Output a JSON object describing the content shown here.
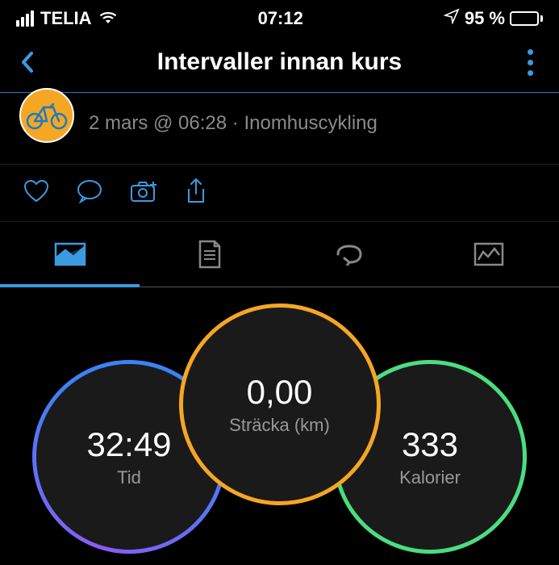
{
  "status": {
    "carrier": "TELIA",
    "time": "07:12",
    "battery_pct": "95 %"
  },
  "nav": {
    "title": "Intervaller innan kurs"
  },
  "activity": {
    "timestamp": "2 mars @ 06:28",
    "type": "Inomhuscykling"
  },
  "metrics": {
    "distance": {
      "value": "0,00",
      "label": "Sträcka (km)"
    },
    "time": {
      "value": "32:49",
      "label": "Tid"
    },
    "calories": {
      "value": "333",
      "label": "Kalorier"
    }
  },
  "colors": {
    "accent_blue": "#3b9ae0",
    "accent_orange": "#f5a623",
    "accent_green": "#4ade80",
    "accent_purple": "#8b5cf6"
  }
}
